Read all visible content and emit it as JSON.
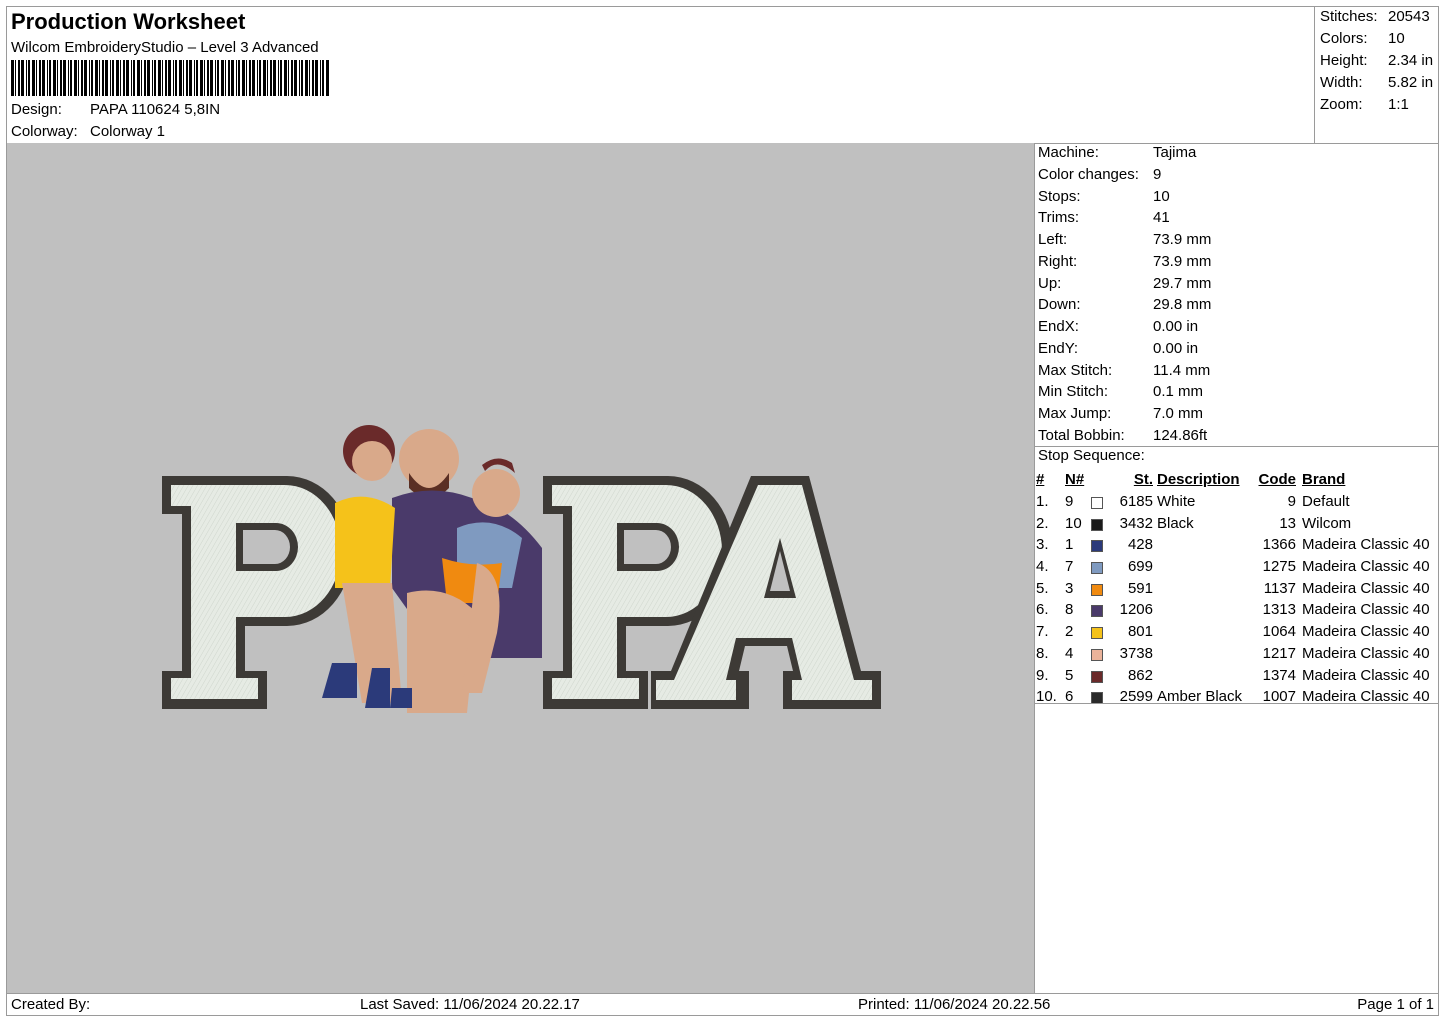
{
  "header": {
    "title": "Production Worksheet",
    "subtitle": "Wilcom EmbroideryStudio – Level 3 Advanced",
    "design_label": "Design:",
    "design_value": "PAPA 110624 5,8IN",
    "colorway_label": "Colorway:",
    "colorway_value": "Colorway 1"
  },
  "stats": [
    {
      "label": "Stitches:",
      "value": "20543"
    },
    {
      "label": "Colors:",
      "value": "10"
    },
    {
      "label": "Height:",
      "value": "2.34 in"
    },
    {
      "label": "Width:",
      "value": "5.82 in"
    },
    {
      "label": "Zoom:",
      "value": "1:1"
    }
  ],
  "design_preview": {
    "text": "PAPA",
    "fill_color": "#e6ebe4",
    "outline_color": "#3d3a36",
    "background": "#c0c0c0"
  },
  "properties": [
    {
      "label": "Machine:",
      "value": "Tajima"
    },
    {
      "label": "Color changes:",
      "value": "9"
    },
    {
      "label": "Stops:",
      "value": "10"
    },
    {
      "label": "Trims:",
      "value": "41"
    },
    {
      "label": "Left:",
      "value": "73.9 mm"
    },
    {
      "label": "Right:",
      "value": "73.9 mm"
    },
    {
      "label": "Up:",
      "value": "29.7 mm"
    },
    {
      "label": "Down:",
      "value": "29.8 mm"
    },
    {
      "label": "EndX:",
      "value": "0.00 in"
    },
    {
      "label": "EndY:",
      "value": "0.00 in"
    },
    {
      "label": "Max Stitch:",
      "value": "11.4 mm"
    },
    {
      "label": "Min Stitch:",
      "value": "0.1 mm"
    },
    {
      "label": "Max Jump:",
      "value": "7.0 mm"
    },
    {
      "label": "Total Bobbin:",
      "value": "124.86ft"
    }
  ],
  "stop_sequence": {
    "title": "Stop Sequence:",
    "headers": [
      "#",
      "N#",
      "St.",
      "Description",
      "Code",
      "Brand"
    ],
    "rows": [
      {
        "num": "1.",
        "n": "9",
        "color": "#ffffff",
        "st": "6185",
        "desc": "White",
        "code": "9",
        "brand": "Default"
      },
      {
        "num": "2.",
        "n": "10",
        "color": "#1a1a1a",
        "st": "3432",
        "desc": "Black",
        "code": "13",
        "brand": "Wilcom"
      },
      {
        "num": "3.",
        "n": "1",
        "color": "#2b3a7a",
        "st": "428",
        "desc": "",
        "code": "1366",
        "brand": "Madeira Classic 40"
      },
      {
        "num": "4.",
        "n": "7",
        "color": "#7f9ac0",
        "st": "699",
        "desc": "",
        "code": "1275",
        "brand": "Madeira Classic 40"
      },
      {
        "num": "5.",
        "n": "3",
        "color": "#f08a10",
        "st": "591",
        "desc": "",
        "code": "1137",
        "brand": "Madeira Classic 40"
      },
      {
        "num": "6.",
        "n": "8",
        "color": "#4a3a6a",
        "st": "1206",
        "desc": "",
        "code": "1313",
        "brand": "Madeira Classic 40"
      },
      {
        "num": "7.",
        "n": "2",
        "color": "#f5c21a",
        "st": "801",
        "desc": "",
        "code": "1064",
        "brand": "Madeira Classic 40"
      },
      {
        "num": "8.",
        "n": "4",
        "color": "#eab39a",
        "st": "3738",
        "desc": "",
        "code": "1217",
        "brand": "Madeira Classic 40"
      },
      {
        "num": "9.",
        "n": "5",
        "color": "#6a2a2a",
        "st": "862",
        "desc": "",
        "code": "1374",
        "brand": "Madeira Classic 40"
      },
      {
        "num": "10.",
        "n": "6",
        "color": "#2a2a2a",
        "st": "2599",
        "desc": "Amber Black",
        "code": "1007",
        "brand": "Madeira Classic 40"
      }
    ]
  },
  "footer": {
    "created_by": "Created By:",
    "last_saved": "Last Saved: 11/06/2024 20.22.17",
    "printed": "Printed: 11/06/2024 20.22.56",
    "page": "Page 1 of 1"
  }
}
